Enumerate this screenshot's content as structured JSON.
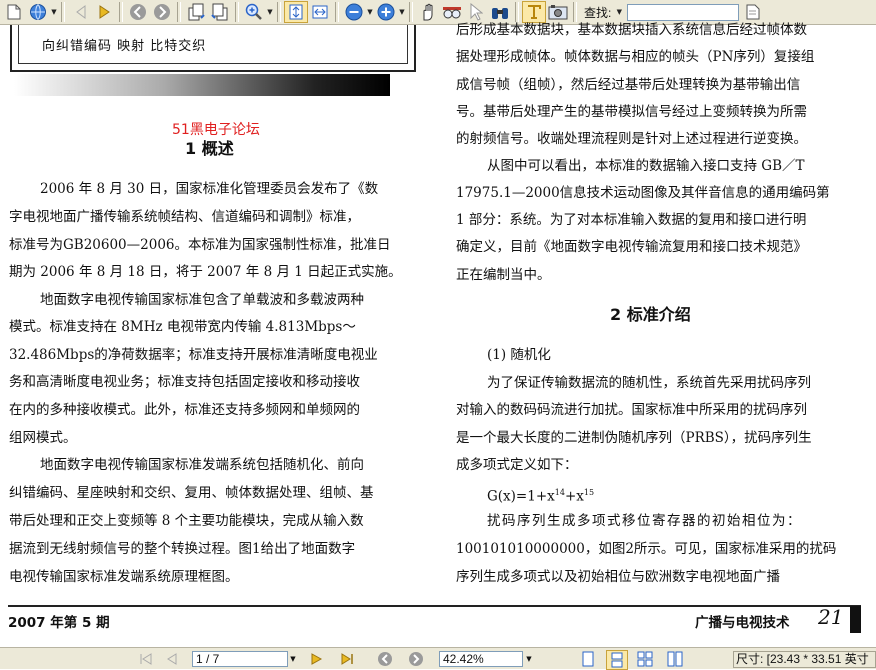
{
  "toolbar": {
    "find_label": "查找:",
    "find_value": ""
  },
  "document": {
    "figure_text": "向纠错编码    映射    比特交织",
    "watermark": "51黑电子论坛",
    "left_lines": [
      "2006 年 8 月 30 日，国家标准化管理委员会发布了《数",
      "字电视地面广播传输系统帧结构、信道编码和调制》标准，",
      "标准号为GB20600—2006。本标准为国家强制性标准，批准日",
      "期为 2006 年 8 月 18 日，将于 2007 年 8 月 1 日起正式实施。",
      "地面数字电视传输国家标准包含了单载波和多载波两种",
      "模式。标准支持在 8MHz 电视带宽内传输 4.813Mbps～",
      "32.486Mbps的净荷数据率；标准支持开展标准清晰度电视业",
      "务和高清晰度电视业务；标准支持包括固定接收和移动接收",
      "在内的多种接收模式。此外，标准还支持多频网和单频网的",
      "组网模式。",
      "地面数字电视传输国家标准发端系统包括随机化、前向",
      "纠错编码、星座映射和交织、复用、帧体数据处理、组帧、基",
      "带后处理和正交上变频等 8 个主要功能模块，完成从输入数",
      "据流到无线射频信号的整个转换过程。图1给出了地面数字",
      "电视传输国家标准发端系统原理框图。"
    ],
    "left_heading": "1  概述",
    "right_lines_a": [
      "后形成基本数据块，基本数据块插入系统信息后经过帧体数",
      "据处理形成帧体。帧体数据与相应的帧头（PN序列）复接组",
      "成信号帧（组帧），然后经过基带后处理转换为基带输出信",
      "号。基带后处理产生的基带模拟信号经过上变频转换为所需",
      "的射频信号。收端处理流程则是针对上述过程进行逆变换。",
      "从图中可以看出，本标准的数据输入接口支持 GB／T",
      "17975.1—2000信息技术运动图像及其伴音信息的通用编码第",
      "1 部分：系统。为了对本标准输入数据的复用和接口进行明",
      "确定义，目前《地面数字电视传输流复用和接口技术规范》",
      "正在编制当中。"
    ],
    "right_heading": "2  标准介绍",
    "right_subheading": "(1) 随机化",
    "right_lines_b": [
      "为了保证传输数据流的随机性，系统首先采用扰码序列",
      "对输入的数码码流进行加扰。国家标准中所采用的扰码序列",
      "是一个最大长度的二进制伪随机序列（PRBS），扰码序列生",
      "成多项式定义如下："
    ],
    "formula": "G(x)=1+x",
    "formula_exp1": "14",
    "formula_plus": "+x",
    "formula_exp2": "15",
    "right_lines_c": [
      "扰码序列生成多项式移位寄存器的初始相位为：",
      "100101010000000，如图2所示。可见，国家标准采用的扰码",
      "序列生成多项式以及初始相位与欧洲数字电视地面广播"
    ],
    "footer_left": "2007 年第 5 期",
    "footer_right": "广播与电视技术",
    "footer_page": "21"
  },
  "statusbar": {
    "page_indicator": "1 / 7",
    "zoom": "42.42%",
    "dimensions": "尺寸: [23.43 * 33.51 英寸"
  },
  "colors": {
    "toolbar_bg": "#ece9d8",
    "watermark": "#e02020",
    "icon_blue": "#2a64c8",
    "icon_gold": "#d4a017"
  }
}
